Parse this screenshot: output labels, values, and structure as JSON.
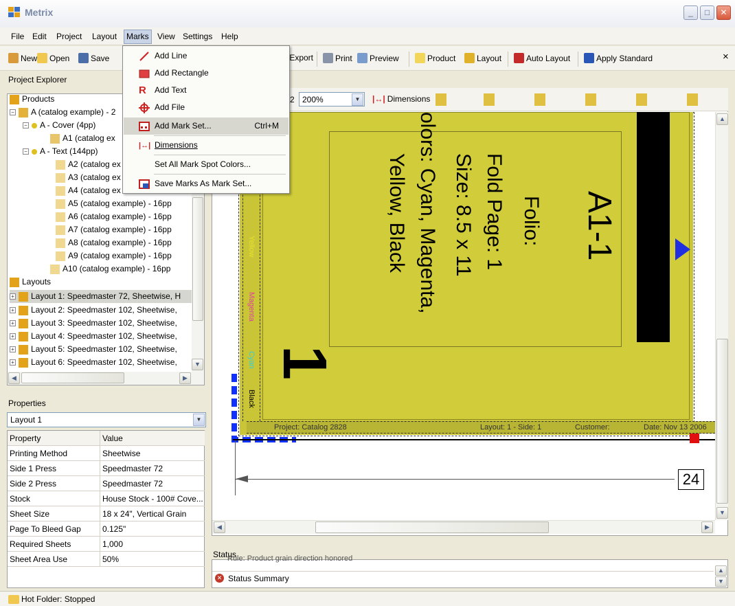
{
  "window": {
    "title": "Metrix"
  },
  "menubar": [
    "File",
    "Edit",
    "Project",
    "Layout",
    "Marks",
    "View",
    "Settings",
    "Help"
  ],
  "toolbar": {
    "new": "New",
    "open": "Open",
    "save": "Save",
    "export": "Export",
    "print": "Print",
    "preview": "Preview",
    "product": "Product",
    "layout": "Layout",
    "auto_layout": "Auto Layout",
    "apply_standard": "Apply Standard",
    "close": "×"
  },
  "marks_menu": {
    "add_line": "Add Line",
    "add_rectangle": "Add Rectangle",
    "add_text": "Add Text",
    "add_file": "Add File",
    "add_mark_set": "Add Mark Set...",
    "add_mark_set_shortcut": "Ctrl+M",
    "dimensions": "Dimensions",
    "set_spot_colors": "Set All Mark Spot Colors...",
    "save_marks": "Save Marks As Mark Set..."
  },
  "project_explorer": {
    "title": "Project Explorer",
    "products_label": "Products",
    "product_a": "A (catalog example) - 2",
    "cover": "A - Cover (4pp)",
    "a1": "A1 (catalog ex",
    "text": "A - Text (144pp)",
    "pages": [
      "A2 (catalog ex",
      "A3 (catalog ex",
      "A4 (catalog ex",
      "A5 (catalog example) - 16pp",
      "A6 (catalog example) - 16pp",
      "A7 (catalog example) - 16pp",
      "A8 (catalog example) - 16pp",
      "A9 (catalog example) - 16pp",
      "A10 (catalog example) - 16pp"
    ],
    "layouts_label": "Layouts",
    "layouts": [
      "Layout 1: Speedmaster 72, Sheetwise, H",
      "Layout 2: Speedmaster 102, Sheetwise,",
      "Layout 3: Speedmaster 102, Sheetwise,",
      "Layout 4: Speedmaster 102, Sheetwise,",
      "Layout 5: Speedmaster 102, Sheetwise,",
      "Layout 6: Speedmaster 102, Sheetwise,"
    ]
  },
  "properties": {
    "title": "Properties",
    "selected": "Layout 1",
    "header": {
      "property": "Property",
      "value": "Value"
    },
    "rows": [
      {
        "k": "Printing Method",
        "v": "Sheetwise"
      },
      {
        "k": "Side 1 Press",
        "v": "Speedmaster 72"
      },
      {
        "k": "Side 2 Press",
        "v": "Speedmaster 72"
      },
      {
        "k": "Stock",
        "v": "House Stock - 100# Cove..."
      },
      {
        "k": "Sheet Size",
        "v": "18 x 24\", Vertical Grain"
      },
      {
        "k": "Page To Bleed Gap",
        "v": "0.125\""
      },
      {
        "k": "Required Sheets",
        "v": "1,000"
      },
      {
        "k": "Sheet Area Use",
        "v": "50%"
      }
    ]
  },
  "canvas_toolbar": {
    "zoom_prefix": "2",
    "zoom": "200%",
    "dimensions": "Dimensions"
  },
  "page": {
    "id": "A1-1",
    "folio": "Folio:",
    "fold_page": "Fold Page: 1",
    "size": "Size: 8.5 x 11",
    "colors_line1": "olors: Cyan, Magenta,",
    "colors_line2": "Yellow, Black",
    "big_number": "1",
    "bar_labels": {
      "yellow": "Yellow",
      "magenta": "Magenta",
      "cyan": "Cyan",
      "black": "Black"
    },
    "bottom_info": {
      "project": "Project: Catalog 2828",
      "layout": "Layout: 1 - Side: 1",
      "customer": "Customer:",
      "date": "Date: Nov 13 2006"
    },
    "dimension_value": "24"
  },
  "status": {
    "title": "Status",
    "cut_row": "Rule: Product grain direction honored",
    "summary": "Status Summary"
  },
  "bottom": {
    "hot_folder": "Hot Folder: Stopped"
  }
}
